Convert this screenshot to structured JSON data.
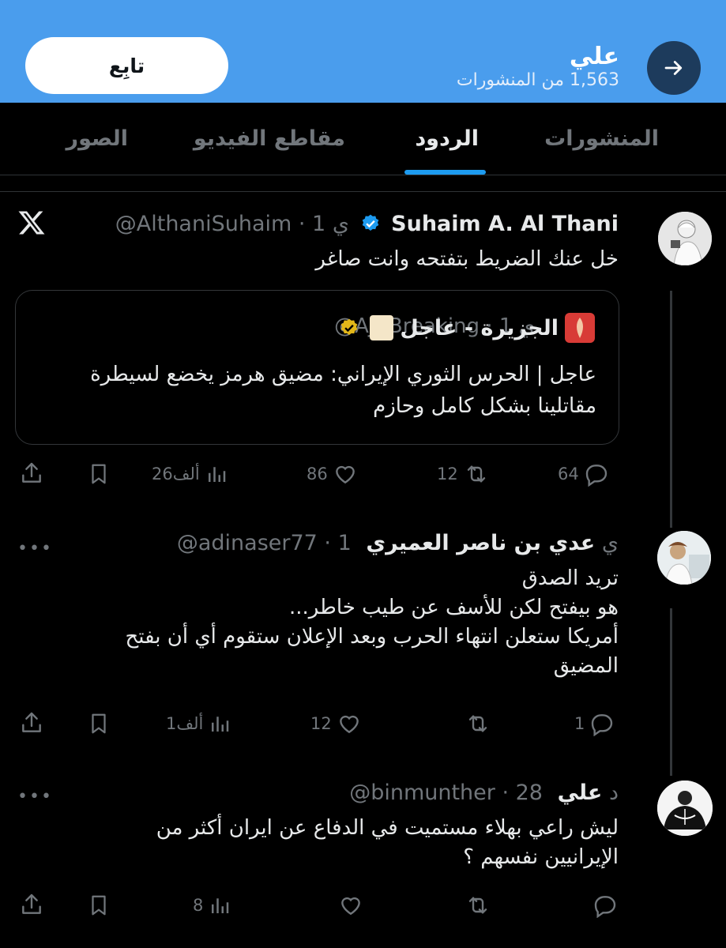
{
  "header": {
    "name": "علي",
    "post_count": "1,563 من المنشورات",
    "follow_label": "تابِع"
  },
  "tabs": [
    {
      "label": "المنشورات",
      "active": false
    },
    {
      "label": "الردود",
      "active": true
    },
    {
      "label": "مقاطع الفيديو",
      "active": false
    },
    {
      "label": "الصور",
      "active": false
    }
  ],
  "tweets": [
    {
      "name": "Suhaim A. Al Thani",
      "verified": true,
      "handle_meta": "@AlthaniSuhaim · 1 ي",
      "text": "خل عنك الضريط بتفتحه وانت صاغر",
      "corner_icon": "x-logo-icon",
      "quote": {
        "name": "الجزيرة - عاجل",
        "handle_meta": "@AJABreaking · 1 ي",
        "text": "عاجل | الحرس الثوري الإيراني: مضيق هرمز يخضع لسيطرة مقاتلينا بشكل كامل وحازم"
      },
      "actions": {
        "replies": "64",
        "reposts": "12",
        "likes": "86",
        "views": "26ألف"
      }
    },
    {
      "name": "عدي بن ناصر العميري",
      "verified": false,
      "handle_meta": "@adinaser77 · 1 ي",
      "text_lines": [
        "تريد الصدق",
        "هو بيفتح لكن للأسف عن طيب خاطر...",
        "أمريكا ستعلن انتهاء الحرب وبعد الإعلان ستقوم أي أن بفتح",
        "المضيق"
      ],
      "actions": {
        "replies": "1",
        "reposts": "",
        "likes": "12",
        "views": "1ألف"
      }
    },
    {
      "name": "علي",
      "verified": false,
      "handle_meta": "@binmunther · 28 د",
      "text_lines": [
        "ليش راعي بهلاء مستميت في الدفاع عن ايران أكثر من",
        "الإيرانيين نفسهم ؟"
      ],
      "actions": {
        "replies": "",
        "reposts": "",
        "likes": "",
        "views": "8"
      }
    }
  ],
  "colors": {
    "header_bg": "#4a9ded",
    "accent": "#1d9bf0",
    "background": "#000000",
    "muted": "#71767b"
  }
}
